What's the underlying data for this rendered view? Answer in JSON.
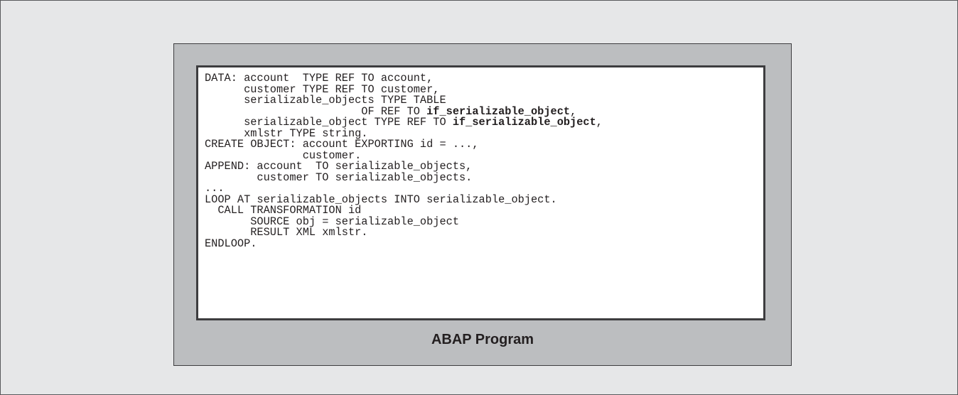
{
  "program": {
    "label": "ABAP Program",
    "code_lines": [
      [
        {
          "text": "DATA: account  TYPE REF TO account,"
        }
      ],
      [
        {
          "text": "      customer TYPE REF TO customer,"
        }
      ],
      [
        {
          "text": "      serializable_objects TYPE TABLE"
        }
      ],
      [
        {
          "text": "                        OF REF TO "
        },
        {
          "text": "if_serializable_object",
          "bold": true
        },
        {
          "text": ","
        }
      ],
      [
        {
          "text": "      serializable_object TYPE REF TO "
        },
        {
          "text": "if_serializable_object",
          "bold": true
        },
        {
          "text": ","
        }
      ],
      [
        {
          "text": "      xmlstr TYPE string."
        }
      ],
      [
        {
          "text": "CREATE OBJECT: account EXPORTING id = ...,"
        }
      ],
      [
        {
          "text": "               customer."
        }
      ],
      [
        {
          "text": "APPEND: account  TO serializable_objects,"
        }
      ],
      [
        {
          "text": "        customer TO serializable_objects."
        }
      ],
      [
        {
          "text": "..."
        }
      ],
      [
        {
          "text": "LOOP AT serializable_objects INTO serializable_object."
        }
      ],
      [
        {
          "text": "  CALL TRANSFORMATION id"
        }
      ],
      [
        {
          "text": "       SOURCE obj = serializable_object"
        }
      ],
      [
        {
          "text": "       RESULT XML xmlstr."
        }
      ],
      [
        {
          "text": "ENDLOOP."
        }
      ]
    ]
  }
}
